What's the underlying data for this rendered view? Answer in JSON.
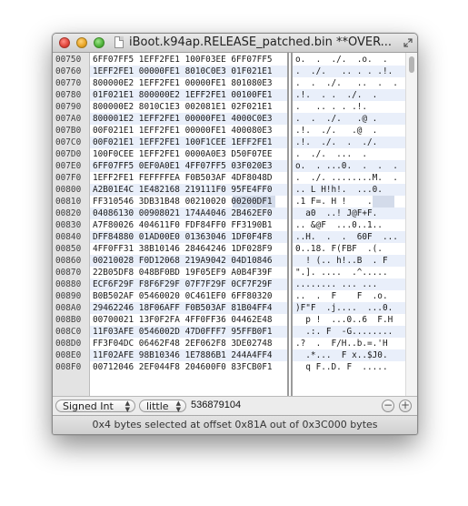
{
  "window": {
    "title": "iBoot.k94ap.RELEASE_patched.bin **OVER..."
  },
  "offsets": [
    "00750",
    "00760",
    "00770",
    "00780",
    "00790",
    "007A0",
    "007B0",
    "007C0",
    "007D0",
    "007E0",
    "007F0",
    "00800",
    "00810",
    "00820",
    "00830",
    "00840",
    "00850",
    "00860",
    "00870",
    "00880",
    "00890",
    "008A0",
    "008B0",
    "008C0",
    "008D0",
    "008E0",
    "008F0"
  ],
  "hex_rows": [
    "6FF07FF5 1EFF2FE1 100F03EE 6FF07FF5",
    "1EFF2FE1 00000FE1 8010C0E3 01F021E1",
    "800000E2 1EFF2FE1 00000FE1 801080E3",
    "01F021E1 800000E2 1EFF2FE1 00100FE1",
    "800000E2 8010C1E3 002081E1 02F021E1",
    "800001E2 1EFF2FE1 00000FE1 4000C0E3",
    "00F021E1 1EFF2FE1 00000FE1 400080E3",
    "00F021E1 1EFF2FE1 100F1CEE 1EFF2FE1",
    "100F0CEE 1EFF2FE1 0000A0E3 D50F07EE",
    "6FF07FF5 0EF0A0E1 4FF07FF5 03F020E3",
    "1EFF2FE1 FEFFFFEA F0B503AF 4DF8048D",
    "A2B01E4C 1E482168 219111F0 95FE4FF0",
    "FF310546 3DB31B48 00210020 00200DF1",
    "04086130 00908021 174A4046 2B462EF0",
    "A7F80026 404611F0 FDF84FF0 FF3190B1",
    "DFF84880 01AD00E0 01363046 1DF0F4F8",
    "4FF0FF31 38B10146 28464246 1DF028F9",
    "00210028 F0D12068 219A9042 04D10846",
    "22B05DF8 048BF0BD 19F05EF9 A0B4F39F",
    "ECF6F29F F8F6F29F 07F7F29F 0CF7F29F",
    "B0B502AF 05460020 0C461EF0 6FF80320",
    "29462246 18F06AFF F0B503AF 81B04FF4",
    "00700021 13F0F2FA 4FF0FF36 04462E48",
    "11F03AFE 0546002D 47D0FFF7 95FFB0F1",
    "FF3F04DC 06462F48 2EF062F8 3DE02748",
    "11F02AFE 98B10346 1E7886B1 244A4FF4",
    "00712046 2EF044F8 204600F0 83FCB0F1"
  ],
  "ascii_rows": [
    "o.  .  ./.  .o.  .",
    ".  ./.   .. . . .!.",
    ".  .  ./.   ..  .  .",
    ".!.  . .  ./.  .",
    ".   .. . . .!.",
    ".  .  ./.   .@ .",
    ".!.  ./.   .@  .",
    ".!.  ./.  .  ./.",
    ".  ./.  ...  .",
    "o.  . ...0.  .  .  .",
    ".  ./. ........M.  .",
    ".. L H!h!.  ...0.",
    ".1 F=. H !    .",
    "  a0  ..! J@F+F.",
    ".. &@F  ...0..1..",
    "..H.  .  .  60F  ...",
    "0..18. F(FBF  .(.",
    "  ! (.. h!..B  . F",
    "\".]. ....  .^.....",
    "........ ... ...",
    "..  .  F    F  .o.",
    ")F\"F  .j....  ...0.",
    "  p !  ...0..6  F.H",
    "  .:. F  -G........",
    ".?  .  F/H..b.=.'H",
    "  .*...  F x..$J0.",
    "  q F..D. F  ....."
  ],
  "controls": {
    "type_popup": "Signed Int",
    "endian_popup": "little",
    "value": "536879104",
    "minus": "−",
    "plus": "+"
  },
  "status": {
    "text": "0x4 bytes selected at offset 0x81A out of 0x3C000 bytes"
  },
  "colors": {
    "stripe": "#e9effa",
    "selection": "#d3dbea"
  }
}
